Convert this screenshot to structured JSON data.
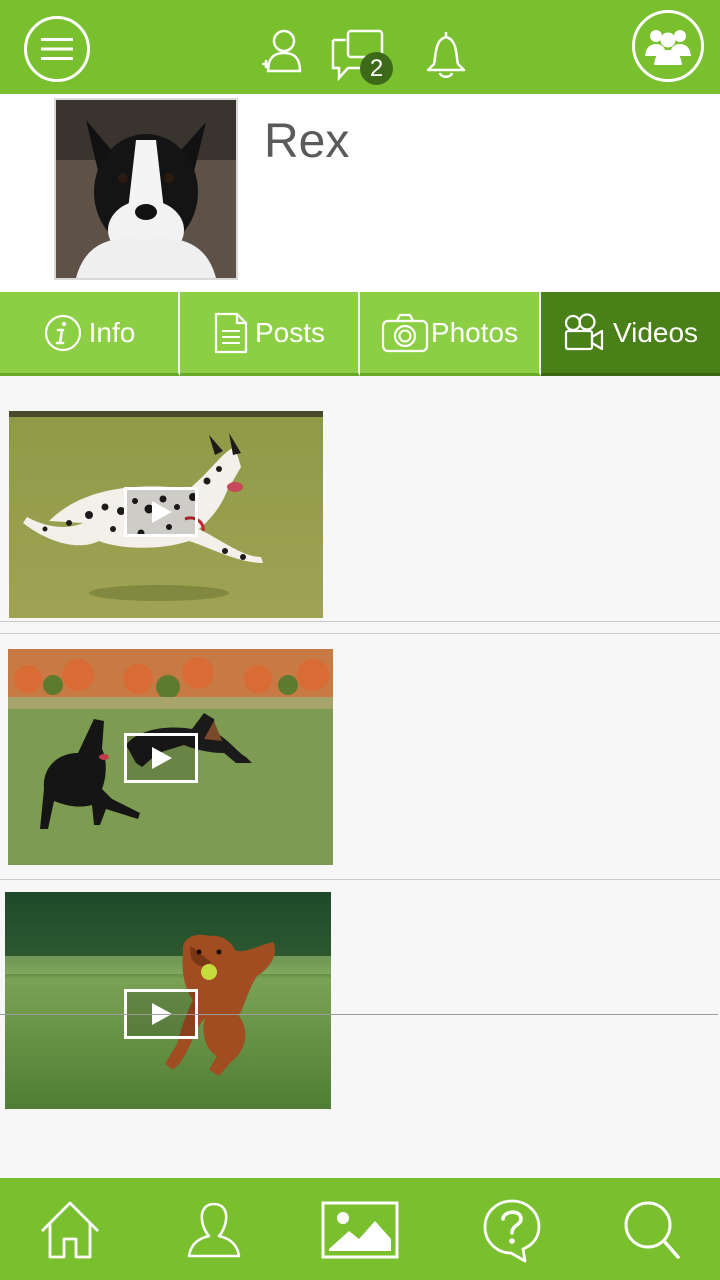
{
  "header": {
    "message_count": "2",
    "icons": [
      "menu-icon",
      "add-friend-icon",
      "messages-icon",
      "bell-icon",
      "group-icon"
    ]
  },
  "profile": {
    "name": "Rex"
  },
  "tabs": [
    {
      "label": "Info",
      "icon": "info-icon",
      "active": false
    },
    {
      "label": "Posts",
      "icon": "document-icon",
      "active": false
    },
    {
      "label": "Photos",
      "icon": "camera-icon",
      "active": false
    },
    {
      "label": "Videos",
      "icon": "video-camera-icon",
      "active": true
    }
  ],
  "videos": [
    {
      "subject": "dalmatian running on grass"
    },
    {
      "subject": "two black dogs running in park"
    },
    {
      "subject": "golden retriever with ball"
    }
  ],
  "bottom_nav": [
    "home-icon",
    "profile-icon",
    "gallery-icon",
    "help-icon",
    "search-icon"
  ],
  "colors": {
    "brand_green": "#79bf2e",
    "tab_green": "#8ccf45",
    "active_tab": "#4a8018",
    "badge": "#3d6a19"
  }
}
